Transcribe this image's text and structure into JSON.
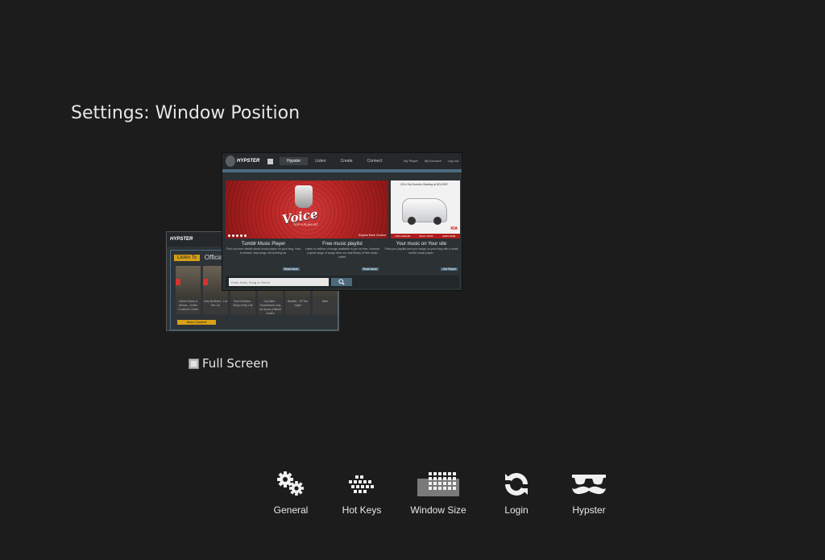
{
  "header": {
    "title": "Settings: Window Position"
  },
  "preview": {
    "main_window": {
      "logo": "HYPSTER",
      "nav_tabs": [
        "Hypster",
        "Listen",
        "Create",
        "Connect"
      ],
      "right_links": [
        "My Player",
        "My Account",
        "Log out"
      ],
      "hero": {
        "title": "Voice",
        "subtitle": "TOP 5 PLAYLIST",
        "explore": "Explore More Content"
      },
      "ad": {
        "text": "2014 Kia Sorento Starting at $24,900*",
        "brand": "KIA",
        "buttons": [
          "FIND A DEALER",
          "BUILD YOURS",
          "LEARN MORE"
        ]
      },
      "columns": [
        {
          "title": "Tumblr Music Player",
          "text": "Find out more details about music player on your blog. How to embed, why songs not working etc.",
          "button": "Read More"
        },
        {
          "title": "Free music playlist",
          "text": "Listen to millions of songs available to you for free. Uncover a great range of songs from our vast library of free music online.",
          "button": "Read More"
        },
        {
          "title": "Your music on Your site",
          "text": "Post your playlist and your songs on your blog with a small tumblr music player.",
          "button": "Get Player"
        }
      ],
      "search": {
        "placeholder": "Enter Artist, Song or Genre"
      }
    },
    "mini_window": {
      "logo": "HYPSTER",
      "tab_active": "Listen To",
      "tab": "Official U",
      "videos": [
        "Calvin Harris & Alesso - Under Control ft. Hurts",
        "Cary Brothers - Let Her Go",
        "One Direction - Story of My Life",
        "Lily Allen - Somewhere only we know (Official Audio)",
        "Bastille - Of The Night",
        "Mich"
      ],
      "more": "More Content"
    }
  },
  "fullscreen": {
    "label": "Full Screen",
    "checked": false
  },
  "toolbar": {
    "items": [
      {
        "label": "General",
        "icon": "gears-icon"
      },
      {
        "label": "Hot Keys",
        "icon": "keyboard-icon"
      },
      {
        "label": "Window Size",
        "icon": "window-size-icon"
      },
      {
        "label": "Login",
        "icon": "refresh-icon"
      },
      {
        "label": "Hypster",
        "icon": "mustache-glasses-icon"
      }
    ]
  }
}
